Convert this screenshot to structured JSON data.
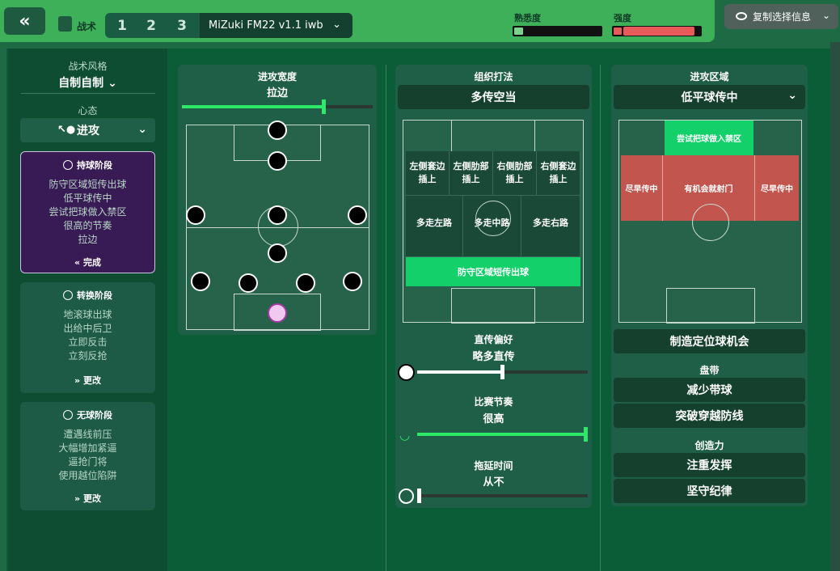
{
  "header": {
    "back_icon": "«",
    "tactics_label": "战术",
    "slots": [
      "1",
      "2",
      "3"
    ],
    "tactic_name": "MiZuki FM22 v1.1 iwb",
    "familiarity_label": "熟悉度",
    "familiarity_level": 0.03,
    "strength_label": "强度",
    "strength_level": 0.93,
    "copy_label": "复制选择信息"
  },
  "left": {
    "style_label": "战术风格",
    "style_value": "自制自制",
    "mentality_label": "心态",
    "mentality_value": "进攻",
    "in_possession": {
      "title": "持球阶段",
      "items": [
        "防守区域短传出球",
        "低平球传中",
        "尝试把球做入禁区",
        "很高的节奏",
        "拉边"
      ],
      "footer": "完成"
    },
    "transition": {
      "title": "转换阶段",
      "items": [
        "地滚球出球",
        "出给中后卫",
        "立即反击",
        "立刻反抢"
      ],
      "footer": "更改"
    },
    "out_of_possession": {
      "title": "无球阶段",
      "items": [
        "遭遇线前压",
        "大幅增加紧逼",
        "逼抢门将",
        "使用越位陷阱"
      ],
      "footer": "更改"
    }
  },
  "width_panel": {
    "title": "进攻宽度",
    "value": "拉边",
    "level": 0.75
  },
  "build_panel": {
    "title": "组织打法",
    "value": "多传空当",
    "cells_row1": [
      "左侧套边插上",
      "左侧肋部插上",
      "右侧肋部插上",
      "右侧套边插上"
    ],
    "cells_row2": [
      "多走左路",
      "多走中路",
      "多走右路"
    ],
    "build_out": "防守区域短传出球",
    "passing_label": "直传偏好",
    "passing_value": "略多直传",
    "passing_level": 0.5,
    "tempo_label": "比赛节奏",
    "tempo_value": "很高",
    "tempo_level": 1.0,
    "timewasting_label": "拖延时间",
    "timewasting_value": "从不",
    "timewasting_level": 0.0
  },
  "attack_panel": {
    "title": "进攻区域",
    "value": "低平球传中",
    "box_label": "尝试把球做入禁区",
    "early_left": "尽早传中",
    "shoot_on_sight": "有机会就射门",
    "early_right": "尽早传中",
    "set_pieces": "制造定位球机会",
    "dribbling_label": "盘带",
    "dribble_1": "减少带球",
    "dribble_2": "突破穿越防线",
    "creativity_label": "创造力",
    "creative_1": "注重发挥",
    "creative_2": "坚守纪律"
  }
}
